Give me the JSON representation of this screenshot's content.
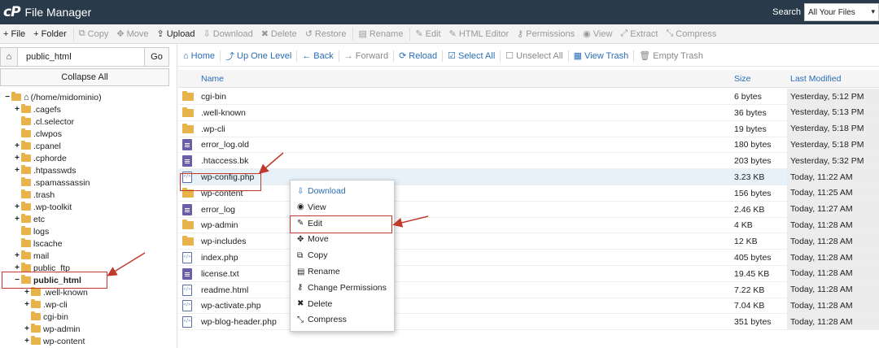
{
  "app": {
    "logo": "cP",
    "title": "File Manager"
  },
  "search": {
    "label": "Search",
    "scope": "All Your Files"
  },
  "toolbar": [
    {
      "icon": "+",
      "label": "File",
      "active": true
    },
    {
      "icon": "+",
      "label": "Folder",
      "active": true
    },
    {
      "icon": "⧉",
      "label": "Copy",
      "active": false
    },
    {
      "icon": "✥",
      "label": "Move",
      "active": false
    },
    {
      "icon": "⇪",
      "label": "Upload",
      "active": true
    },
    {
      "icon": "⇩",
      "label": "Download",
      "active": false
    },
    {
      "icon": "✖",
      "label": "Delete",
      "active": false
    },
    {
      "icon": "↺",
      "label": "Restore",
      "active": false
    },
    {
      "icon": "▤",
      "label": "Rename",
      "active": false
    },
    {
      "icon": "✎",
      "label": "Edit",
      "active": false
    },
    {
      "icon": "✎",
      "label": "HTML Editor",
      "active": false
    },
    {
      "icon": "⚷",
      "label": "Permissions",
      "active": false
    },
    {
      "icon": "◉",
      "label": "View",
      "active": false
    },
    {
      "icon": "⤢",
      "label": "Extract",
      "active": false
    },
    {
      "icon": "⤡",
      "label": "Compress",
      "active": false
    }
  ],
  "left": {
    "path_value": "public_html",
    "go_label": "Go",
    "collapse_label": "Collapse All",
    "tree": [
      {
        "label": "(/home/midominio)",
        "toggle": "−",
        "indent": 0,
        "home": true
      },
      {
        "label": ".cagefs",
        "toggle": "+",
        "indent": 1
      },
      {
        "label": ".cl.selector",
        "toggle": "",
        "indent": 1
      },
      {
        "label": ".clwpos",
        "toggle": "",
        "indent": 1
      },
      {
        "label": ".cpanel",
        "toggle": "+",
        "indent": 1
      },
      {
        "label": ".cphorde",
        "toggle": "+",
        "indent": 1
      },
      {
        "label": ".htpasswds",
        "toggle": "+",
        "indent": 1
      },
      {
        "label": ".spamassassin",
        "toggle": "",
        "indent": 1
      },
      {
        "label": ".trash",
        "toggle": "",
        "indent": 1
      },
      {
        "label": ".wp-toolkit",
        "toggle": "+",
        "indent": 1
      },
      {
        "label": "etc",
        "toggle": "+",
        "indent": 1
      },
      {
        "label": "logs",
        "toggle": "",
        "indent": 1
      },
      {
        "label": "lscache",
        "toggle": "",
        "indent": 1
      },
      {
        "label": "mail",
        "toggle": "+",
        "indent": 1
      },
      {
        "label": "public_ftp",
        "toggle": "+",
        "indent": 1
      },
      {
        "label": "public_html",
        "toggle": "−",
        "indent": 1,
        "bold": true
      },
      {
        "label": ".well-known",
        "toggle": "+",
        "indent": 2
      },
      {
        "label": ".wp-cli",
        "toggle": "+",
        "indent": 2
      },
      {
        "label": "cgi-bin",
        "toggle": "",
        "indent": 2
      },
      {
        "label": "wp-admin",
        "toggle": "+",
        "indent": 2
      },
      {
        "label": "wp-content",
        "toggle": "+",
        "indent": 2
      }
    ]
  },
  "nav": [
    {
      "icon": "⌂",
      "label": "Home",
      "disabled": false
    },
    {
      "icon": "⤴",
      "label": "Up One Level",
      "disabled": false
    },
    {
      "icon": "←",
      "label": "Back",
      "disabled": false
    },
    {
      "icon": "→",
      "label": "Forward",
      "disabled": true
    },
    {
      "icon": "⟳",
      "label": "Reload",
      "disabled": false
    },
    {
      "icon": "☑",
      "label": "Select All",
      "disabled": false
    },
    {
      "icon": "☐",
      "label": "Unselect All",
      "disabled": true
    },
    {
      "icon": "▦",
      "label": "View Trash",
      "disabled": false
    },
    {
      "icon": "🗑",
      "label": "Empty Trash",
      "disabled": true
    }
  ],
  "table": {
    "headers": {
      "name": "Name",
      "size": "Size",
      "modified": "Last Modified"
    },
    "rows": [
      {
        "name": "cgi-bin",
        "size": "6 bytes",
        "modified": "Yesterday, 5:12 PM",
        "type": "dir"
      },
      {
        "name": ".well-known",
        "size": "36 bytes",
        "modified": "Yesterday, 5:13 PM",
        "type": "dir"
      },
      {
        "name": ".wp-cli",
        "size": "19 bytes",
        "modified": "Yesterday, 5:18 PM",
        "type": "dir"
      },
      {
        "name": "error_log.old",
        "size": "180 bytes",
        "modified": "Yesterday, 5:18 PM",
        "type": "doc"
      },
      {
        "name": ".htaccess.bk",
        "size": "203 bytes",
        "modified": "Yesterday, 5:32 PM",
        "type": "doc"
      },
      {
        "name": "wp-config.php",
        "size": "3.23 KB",
        "modified": "Today, 11:22 AM",
        "type": "code",
        "selected": true
      },
      {
        "name": "wp-content",
        "size": "156 bytes",
        "modified": "Today, 11:25 AM",
        "type": "dir"
      },
      {
        "name": "error_log",
        "size": "2.46 KB",
        "modified": "Today, 11:27 AM",
        "type": "doc"
      },
      {
        "name": "wp-admin",
        "size": "4 KB",
        "modified": "Today, 11:28 AM",
        "type": "dir"
      },
      {
        "name": "wp-includes",
        "size": "12 KB",
        "modified": "Today, 11:28 AM",
        "type": "dir"
      },
      {
        "name": "index.php",
        "size": "405 bytes",
        "modified": "Today, 11:28 AM",
        "type": "code"
      },
      {
        "name": "license.txt",
        "size": "19.45 KB",
        "modified": "Today, 11:28 AM",
        "type": "doc"
      },
      {
        "name": "readme.html",
        "size": "7.22 KB",
        "modified": "Today, 11:28 AM",
        "type": "code"
      },
      {
        "name": "wp-activate.php",
        "size": "7.04 KB",
        "modified": "Today, 11:28 AM",
        "type": "code"
      },
      {
        "name": "wp-blog-header.php",
        "size": "351 bytes",
        "modified": "Today, 11:28 AM",
        "type": "code"
      }
    ]
  },
  "context_menu": [
    {
      "icon": "⇩",
      "label": "Download"
    },
    {
      "icon": "◉",
      "label": "View"
    },
    {
      "icon": "✎",
      "label": "Edit"
    },
    {
      "icon": "✥",
      "label": "Move"
    },
    {
      "icon": "⧉",
      "label": "Copy"
    },
    {
      "icon": "▤",
      "label": "Rename"
    },
    {
      "icon": "⚷",
      "label": "Change Permissions"
    },
    {
      "icon": "✖",
      "label": "Delete"
    },
    {
      "icon": "⤡",
      "label": "Compress"
    }
  ],
  "colors": {
    "topbar": "#293a4a",
    "link": "#2a6db5",
    "annotation": "#c0392b",
    "folder": "#e8b34a"
  }
}
